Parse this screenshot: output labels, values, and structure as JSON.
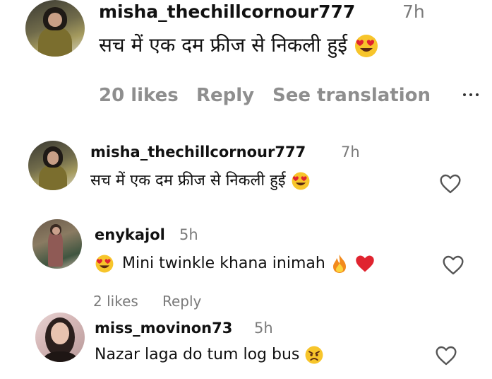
{
  "comments": [
    {
      "username": "misha_thechillcornour777",
      "time": "7h",
      "text": "सच में एक दम फ्रीज से निकली हुई",
      "likes": "20 likes",
      "reply": "Reply",
      "see_translation": "See translation"
    },
    {
      "username": "misha_thechillcornour777",
      "time": "7h",
      "text": "सच में एक दम फ्रीज से निकली हुई"
    },
    {
      "username": "enykajol",
      "time": "5h",
      "text": "Mini twinkle khana inimah",
      "likes": "2 likes",
      "reply": "Reply"
    },
    {
      "username": "miss_movinon73",
      "time": "5h",
      "text": "Nazar laga do tum log bus"
    }
  ],
  "icons": {
    "heart_eyes": "heart-eyes-emoji",
    "fire": "fire-emoji",
    "red_heart": "red-heart-emoji",
    "pouting": "pouting-face-emoji",
    "like": "heart-outline-icon",
    "more": "more-dots-icon"
  },
  "colors": {
    "secondary_text": "#8e8e8e",
    "emoji_yellow": "#f7c52b",
    "heart_red": "#e0242f"
  }
}
